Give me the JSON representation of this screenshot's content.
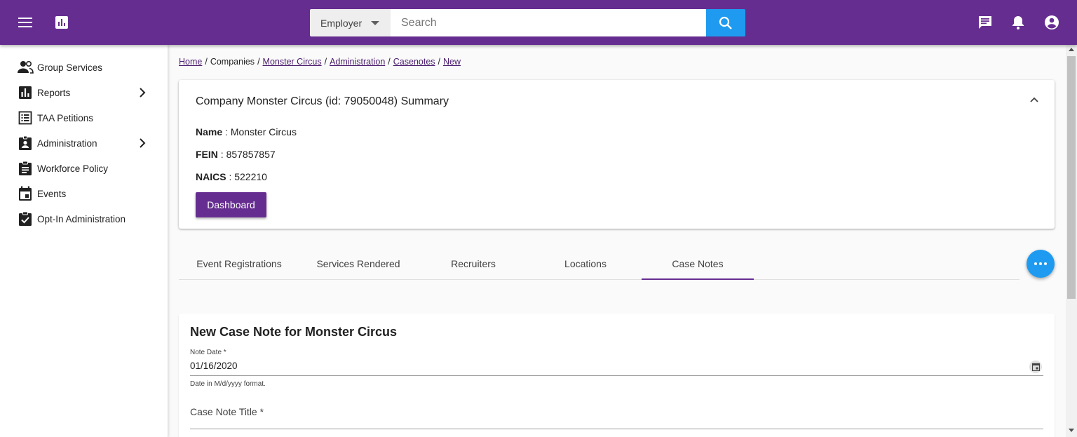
{
  "header": {
    "search_category": "Employer",
    "search_placeholder": "Search",
    "colors": {
      "brand": "#662d91",
      "accent": "#1e9bf0"
    }
  },
  "sidebar": {
    "items": [
      {
        "label": "Group Services",
        "icon": "group-icon",
        "has_children": false
      },
      {
        "label": "Reports",
        "icon": "bar-chart-icon",
        "has_children": true
      },
      {
        "label": "TAA Petitions",
        "icon": "list-icon",
        "has_children": false
      },
      {
        "label": "Administration",
        "icon": "badge-icon",
        "has_children": true
      },
      {
        "label": "Workforce Policy",
        "icon": "clipboard-icon",
        "has_children": false
      },
      {
        "label": "Events",
        "icon": "calendar-icon",
        "has_children": false
      },
      {
        "label": "Opt-In Administration",
        "icon": "checklist-icon",
        "has_children": false
      }
    ]
  },
  "breadcrumb": {
    "home": "Home",
    "companies": "Companies",
    "company": "Monster Circus",
    "administration": "Administration",
    "casenotes": "Casenotes",
    "new": "New",
    "separator": "/"
  },
  "summary": {
    "title": "Company Monster Circus (id: 79050048) Summary",
    "fields": [
      {
        "label": "Name",
        "value": "Monster Circus"
      },
      {
        "label": "FEIN",
        "value": "857857857"
      },
      {
        "label": "NAICS",
        "value": "522210"
      }
    ],
    "dashboard_label": "Dashboard"
  },
  "tabs": [
    {
      "label": "Event Registrations",
      "active": false
    },
    {
      "label": "Services Rendered",
      "active": false
    },
    {
      "label": "Recruiters",
      "active": false
    },
    {
      "label": "Locations",
      "active": false
    },
    {
      "label": "Case Notes",
      "active": true
    }
  ],
  "form": {
    "title": "New Case Note for Monster Circus",
    "note_date_label": "Note Date *",
    "note_date_value": "01/16/2020",
    "note_date_hint": "Date in M/d/yyyy format.",
    "case_note_title_label": "Case Note Title *"
  }
}
